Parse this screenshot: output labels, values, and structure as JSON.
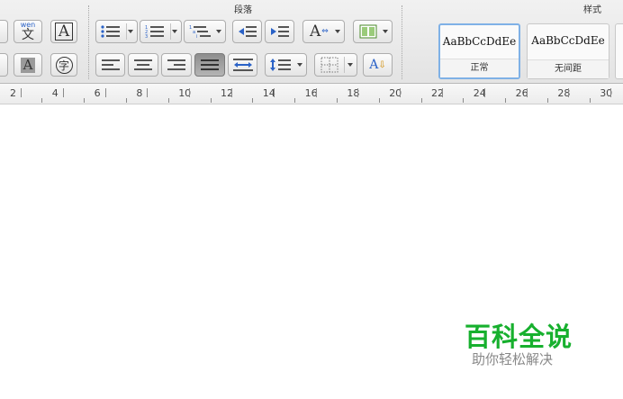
{
  "ribbon": {
    "groups": {
      "paragraph": "段落",
      "styles": "样式"
    },
    "font_row1": {
      "phonetic_top": "wen",
      "phonetic_char": "文",
      "char_border": "A"
    },
    "font_row2": {
      "char_shading": "A",
      "enclose_char": "字"
    },
    "styles": [
      {
        "sample": "AaBbCcDdEe",
        "name": "正常",
        "selected": true
      },
      {
        "sample": "AaBbCcDdEe",
        "name": "无间距",
        "selected": false
      }
    ],
    "text_direction_glyph": "A",
    "sort_glyph": "A"
  },
  "ruler": {
    "labels": [
      "2",
      "4",
      "6",
      "8",
      "10",
      "12",
      "14",
      "16",
      "18",
      "20",
      "22",
      "24",
      "26",
      "28",
      "30"
    ]
  },
  "watermark": {
    "title": "百科全说",
    "subtitle": "助你轻松解决"
  },
  "colors": {
    "watermark_green": "#17b02e",
    "selected_style_border": "#7fb1e6"
  }
}
